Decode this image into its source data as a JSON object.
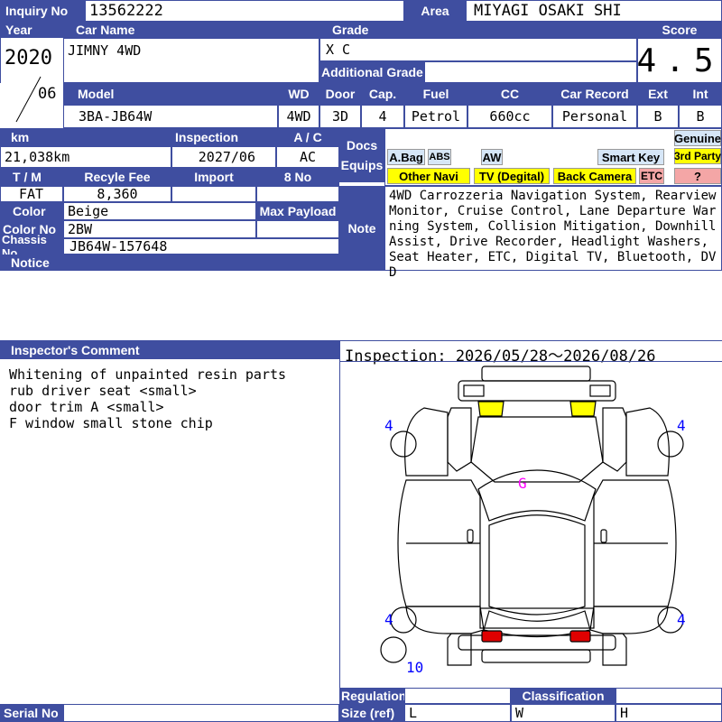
{
  "header": {
    "inquiry_label": "Inquiry No",
    "inquiry_value": "13562222",
    "area_label": "Area",
    "area_value": "MIYAGI OSAKI SHI"
  },
  "car": {
    "year_label": "Year",
    "year_value": "2020",
    "month_value": "06",
    "name_label": "Car Name",
    "name_value": "JIMNY 4WD",
    "grade_label": "Grade",
    "grade_value": "X C",
    "additional_grade_label": "Additional Grade",
    "score_label": "Score",
    "score_value": "4.5"
  },
  "model_row": {
    "model_label": "Model",
    "model_value": "3BA-JB64W",
    "wd_label": "WD",
    "wd_value": "4WD",
    "door_label": "Door",
    "door_value": "3D",
    "cap_label": "Cap.",
    "cap_value": "4",
    "fuel_label": "Fuel",
    "fuel_value": "Petrol",
    "cc_label": "CC",
    "cc_value": "660cc",
    "record_label": "Car Record",
    "record_value": "Personal",
    "ext_label": "Ext",
    "ext_value": "B",
    "int_label": "Int",
    "int_value": "B"
  },
  "details": {
    "km_label": "km",
    "km_value": "21,038km",
    "inspection_label": "Inspection",
    "inspection_value": "2027/06",
    "ac_label": "A / C",
    "ac_value": "AC",
    "tm_label": "T / M",
    "tm_value": "FAT",
    "recycle_label": "Recyle Fee",
    "recycle_value": "8,360",
    "import_label": "Import",
    "import_value": "",
    "eight_no_label": "8 No",
    "eight_no_value": "",
    "color_label": "Color",
    "color_value": "Beige",
    "max_payload_label": "Max Payload",
    "color_no_label": "Color No",
    "color_no_value": "2BW",
    "chassis_label": "Chassis No",
    "chassis_value": "JB64W-157648",
    "notice_label": "Notice"
  },
  "equips": {
    "docs_label": "Docs",
    "equips_label": "Equips",
    "abag": "A.Bag",
    "abs": "ABS",
    "aw": "AW",
    "smart_key": "Smart Key",
    "genuine": "Genuine",
    "third_party": "3rd Party",
    "other_navi": "Other Navi",
    "tv": "TV (Degital)",
    "back_camera": "Back Camera",
    "etc": "ETC",
    "question": "?"
  },
  "note": {
    "label": "Note",
    "text": "4WD Carrozzeria Navigation System, Rearview Monitor, Cruise Control, Lane Departure Warning System, Collision Mitigation, Downhill Assist, Drive Recorder, Headlight Washers, Seat Heater, ETC, Digital TV, Bluetooth, DVD"
  },
  "inspector": {
    "label": "Inspector's Comment",
    "lines": [
      "Whitening of unpainted resin parts",
      "rub driver seat <small>",
      "door trim A <small>",
      "F window small stone chip"
    ]
  },
  "diagram": {
    "period": "Inspection: 2026/05/28〜2026/08/26",
    "marks": {
      "fl": "4",
      "fr": "4",
      "rl": "4",
      "rr": "4",
      "glass": "G",
      "spare": "10"
    }
  },
  "footer": {
    "serial_label": "Serial No",
    "regulation_label": "Regulation",
    "size_label": "Size (ref)",
    "classification_label": "Classification",
    "l": "L",
    "w": "W",
    "h": "H"
  },
  "colors": {
    "header_blue": "#3f4ea0",
    "tag_yellow": "#ffff00",
    "mark_blue": "#0000ff",
    "mark_magenta": "#ff00ff",
    "lamp_red": "#e00000"
  }
}
